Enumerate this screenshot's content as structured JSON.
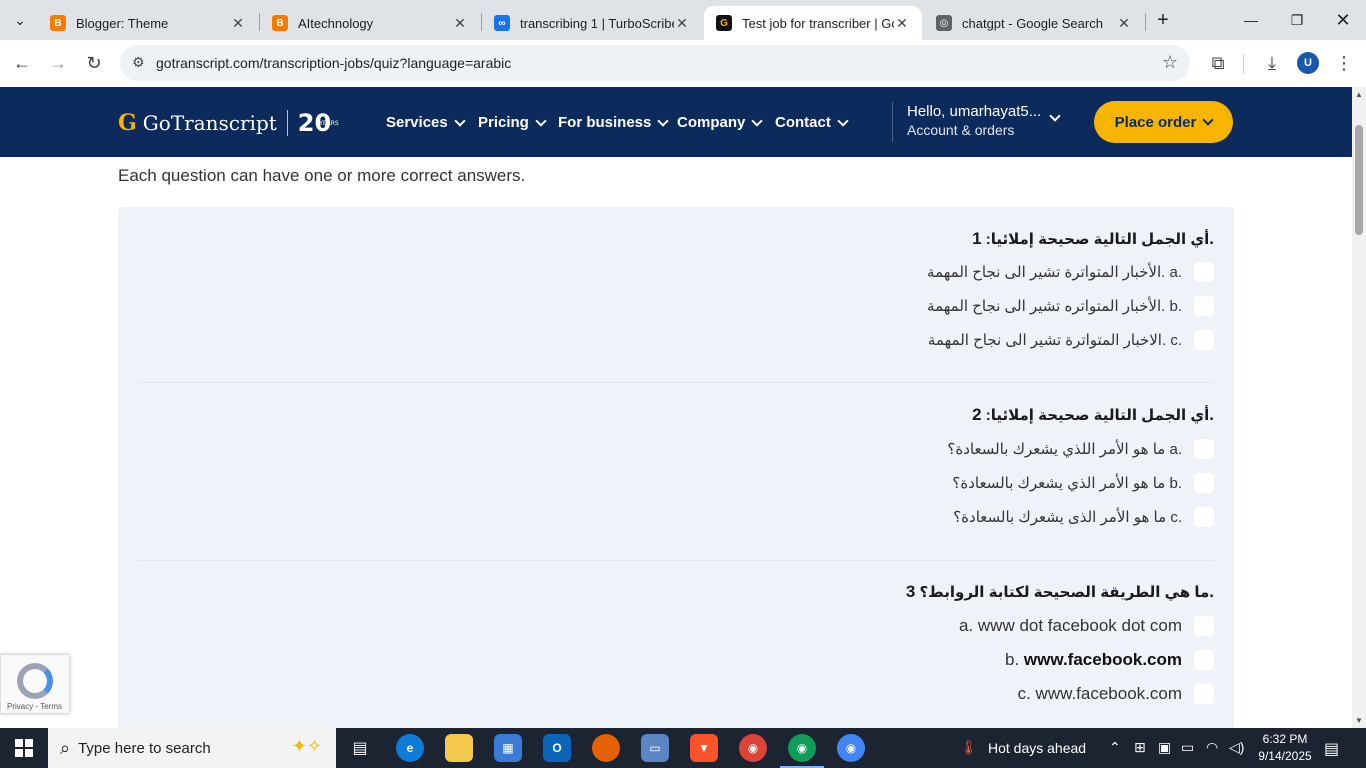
{
  "browser": {
    "tabs": [
      {
        "title": "Blogger: Theme",
        "color": "#f57c00",
        "glyph": "B"
      },
      {
        "title": "AItechnology",
        "color": "#f57c00",
        "glyph": "B"
      },
      {
        "title": "transcribing 1 | TurboScribe",
        "color": "#1a73e8",
        "glyph": "∞"
      },
      {
        "title": "Test job for transcriber | GoT",
        "color": "#111111",
        "glyph": "G"
      },
      {
        "title": "chatgpt - Google Search",
        "color": "#5f6368",
        "glyph": "◎"
      }
    ],
    "active_tab": 3,
    "url": "gotranscript.com/transcription-jobs/quiz?language=arabic",
    "profile_initial": "U"
  },
  "site": {
    "logo_text": "GoTranscript",
    "anniversary": "20",
    "anniversary_small": "YEARS",
    "menu": [
      "Services",
      "Pricing",
      "For business",
      "Company",
      "Contact"
    ],
    "account_hello": "Hello, umarhayat5...",
    "account_orders": "Account & orders",
    "place_order": "Place order",
    "brand_color": "#0c2a5c",
    "accent_color": "#f7b500"
  },
  "page": {
    "intro": "Each question can have one or more correct answers."
  },
  "quiz": [
    {
      "number": "1.",
      "question": "أي الجمل التالية صحيحة إملائيا:",
      "options": [
        {
          "letter": "a.",
          "text": "الأخبار المتواترة تشير الى نجاح المهمة."
        },
        {
          "letter": "b.",
          "text": "الأخبار المتواتره تشير الى نجاح المهمة."
        },
        {
          "letter": "c.",
          "text": "الاخبار المتواترة تشير الى نجاح المهمة."
        }
      ]
    },
    {
      "number": "2.",
      "question": "أي الجمل التالية صحيحة إملائيا:",
      "options": [
        {
          "letter": "a.",
          "text": "ما هو الأمر اللذي يشعرك بالسعادة؟"
        },
        {
          "letter": "b.",
          "text": "ما هو الأمر الذي يشعرك بالسعادة؟"
        },
        {
          "letter": "c.",
          "text": "ما هو الأمر الذى يشعرك بالسعادة؟"
        }
      ]
    },
    {
      "number": "3.",
      "question": "ما هي الطريقة الصحيحة لكتابة الروابط؟",
      "options": [
        {
          "letter": "a.",
          "text": "www dot facebook dot com"
        },
        {
          "letter": "b.",
          "text": "www.facebook.com"
        },
        {
          "letter": "c.",
          "text": "www.facebook.com"
        }
      ]
    }
  ],
  "recaptcha": {
    "privacy": "Privacy",
    "sep": " - ",
    "terms": "Terms"
  },
  "taskbar": {
    "search_placeholder": "Type here to search",
    "weather": "Hot days ahead",
    "time": "6:32 PM",
    "date": "9/14/2025"
  }
}
